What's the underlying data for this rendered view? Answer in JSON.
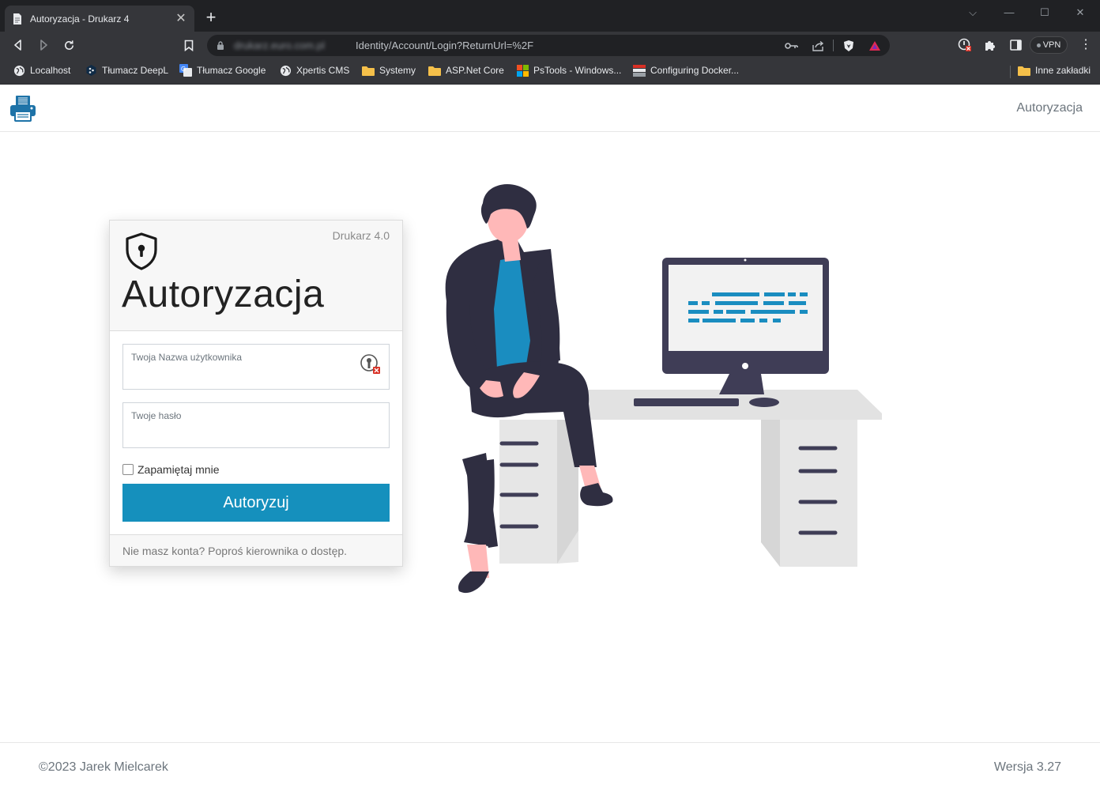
{
  "browser": {
    "tab_title": "Autoryzacja - Drukarz 4",
    "tab_close": "✕",
    "new_tab": "+",
    "url_host": "drukarz.euro.com.pl",
    "url_path": "Identity/Account/Login?ReturnUrl=%2F",
    "vpn_label": "VPN",
    "window_controls": {
      "chevron": "⌵",
      "minimize": "—",
      "maximize": "☐",
      "close": "✕"
    },
    "bookmarks": [
      {
        "label": "Localhost",
        "icon": "globe-icon"
      },
      {
        "label": "Tłumacz DeepL",
        "icon": "deepl-icon"
      },
      {
        "label": "Tłumacz Google",
        "icon": "google-translate-icon"
      },
      {
        "label": "Xpertis CMS",
        "icon": "globe-icon"
      },
      {
        "label": "Systemy",
        "icon": "folder-icon"
      },
      {
        "label": "ASP.Net Core",
        "icon": "folder-icon"
      },
      {
        "label": "PsTools - Windows...",
        "icon": "windows-icon"
      },
      {
        "label": "Configuring Docker...",
        "icon": "docker-page-icon"
      }
    ],
    "other_bookmarks": "Inne zakładki"
  },
  "header": {
    "nav_login": "Autoryzacja"
  },
  "login": {
    "app_version": "Drukarz 4.0",
    "title": "Autoryzacja",
    "username_label": "Twoja Nazwa użytkownika",
    "username_value": "",
    "password_label": "Twoje hasło",
    "password_value": "",
    "remember_label": "Zapamiętaj mnie",
    "remember_checked": false,
    "submit_label": "Autoryzuj",
    "no_account_text": "Nie masz konta? Poproś kierownika o dostęp."
  },
  "footer": {
    "copyright": "©2023 Jarek Mielcarek",
    "version": "Wersja 3.27"
  },
  "colors": {
    "accent": "#1590bd",
    "chrome_dark": "#202124",
    "chrome_toolbar": "#35363a"
  }
}
